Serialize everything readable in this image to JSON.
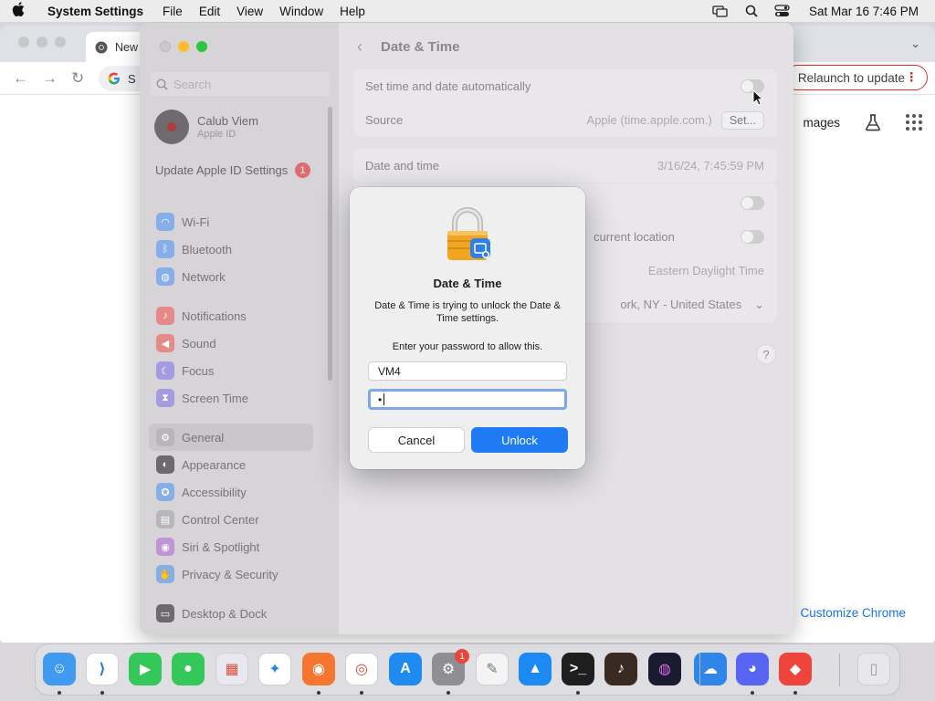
{
  "menubar": {
    "app_name": "System Settings",
    "items": [
      "File",
      "Edit",
      "View",
      "Window",
      "Help"
    ],
    "clock": "Sat Mar 16  7:46 PM"
  },
  "chrome": {
    "tab_title": "New",
    "omnibox_text": "S",
    "relaunch_label": "Relaunch to update",
    "images_link": "mages",
    "customize_label": "Customize Chrome",
    "accent_color": "#1a73e8"
  },
  "settings": {
    "search_placeholder": "Search",
    "account": {
      "name": "Calub Viem",
      "subtitle": "Apple ID"
    },
    "update": {
      "label": "Update Apple ID Settings",
      "badge": "1"
    },
    "sidebar_groups": [
      [
        {
          "label": "Wi-Fi",
          "icon": "wifi-icon",
          "color": "#86aee8"
        },
        {
          "label": "Bluetooth",
          "icon": "bluetooth-icon",
          "color": "#86aee8"
        },
        {
          "label": "Network",
          "icon": "globe-icon",
          "color": "#86aee8"
        }
      ],
      [
        {
          "label": "Notifications",
          "icon": "bell-icon",
          "color": "#e58a88"
        },
        {
          "label": "Sound",
          "icon": "speaker-icon",
          "color": "#e58a88"
        },
        {
          "label": "Focus",
          "icon": "moon-icon",
          "color": "#a49be0"
        },
        {
          "label": "Screen Time",
          "icon": "hourglass-icon",
          "color": "#a49be0"
        }
      ],
      [
        {
          "label": "General",
          "icon": "gear-icon",
          "color": "#b8b6ba"
        },
        {
          "label": "Appearance",
          "icon": "appearance-icon",
          "color": "#6d6a6f"
        },
        {
          "label": "Accessibility",
          "icon": "accessibility-icon",
          "color": "#86aee8"
        },
        {
          "label": "Control Center",
          "icon": "control-center-icon",
          "color": "#b8b6ba"
        },
        {
          "label": "Siri & Spotlight",
          "icon": "siri-icon",
          "color": "#c194d6"
        },
        {
          "label": "Privacy & Security",
          "icon": "hand-icon",
          "color": "#86aee8"
        }
      ],
      [
        {
          "label": "Desktop & Dock",
          "icon": "dock-icon",
          "color": "#6d6a6f"
        }
      ]
    ],
    "page_title": "Date & Time",
    "rows": {
      "auto_label": "Set time and date automatically",
      "source_label": "Source",
      "source_value": "Apple (time.apple.com.)",
      "set_button": "Set...",
      "datetime_label": "Date and time",
      "datetime_value": "3/16/24, 7:45:59 PM",
      "location_label": "current location",
      "timezone_value": "Eastern Daylight Time",
      "city_value": "ork, NY - United States"
    }
  },
  "dialog": {
    "title": "Date & Time",
    "message": "Date & Time is trying to unlock the Date & Time settings.",
    "prompt": "Enter your password to allow this.",
    "username": "VM4",
    "password_mask": "•",
    "cancel": "Cancel",
    "unlock": "Unlock",
    "accent_color": "#1e7bf3"
  },
  "dock": {
    "apps": [
      {
        "name": "finder-icon",
        "glyph": "☺",
        "color": "#3f9af0",
        "running": true
      },
      {
        "name": "vscode-icon",
        "glyph": "⟩",
        "color": "#ffffff",
        "fg": "#2a7ad4",
        "running": true
      },
      {
        "name": "facetime-icon",
        "glyph": "▶",
        "color": "#34c759",
        "running": false
      },
      {
        "name": "messages-icon",
        "glyph": "●",
        "color": "#34c759",
        "running": false
      },
      {
        "name": "launchpad-icon",
        "glyph": "▦",
        "color": "#e8e8ee",
        "fg": "#e0533f",
        "running": false
      },
      {
        "name": "safari-icon",
        "glyph": "✦",
        "color": "#ffffff",
        "fg": "#1f86f0",
        "running": false
      },
      {
        "name": "firefox-icon",
        "glyph": "◉",
        "color": "#f5762e",
        "running": true
      },
      {
        "name": "chrome-icon",
        "glyph": "◎",
        "color": "#ffffff",
        "fg": "#db4437",
        "running": true
      },
      {
        "name": "app-store-icon",
        "glyph": "A",
        "color": "#1f8bf0",
        "running": false
      },
      {
        "name": "system-settings-icon",
        "glyph": "⚙",
        "color": "#8e8e93",
        "running": true,
        "badge": "1"
      },
      {
        "name": "textedit-icon",
        "glyph": "✎",
        "color": "#f4f4f4",
        "fg": "#777",
        "running": false
      },
      {
        "name": "keynote-icon",
        "glyph": "▲",
        "color": "#1c8af2",
        "running": false
      },
      {
        "name": "terminal-icon",
        "glyph": ">_",
        "color": "#1e1e1e",
        "running": true
      },
      {
        "name": "instruments-icon",
        "glyph": "♪",
        "color": "#3a2b22",
        "running": false
      },
      {
        "name": "siri-icon",
        "glyph": "◍",
        "color": "#1b1b2f",
        "fg": "#d36ce8",
        "running": false
      },
      {
        "name": "weather-icon",
        "glyph": "☁",
        "color": "#2f86e8",
        "running": false
      },
      {
        "name": "discord-icon",
        "glyph": "◕",
        "color": "#5865f2",
        "running": true
      },
      {
        "name": "anydesk-icon",
        "glyph": "◆",
        "color": "#ef443b",
        "running": true
      },
      {
        "name": "trash-icon",
        "glyph": "▯",
        "color": "#e8e8ec",
        "fg": "#9a9aa0",
        "running": false
      }
    ]
  }
}
